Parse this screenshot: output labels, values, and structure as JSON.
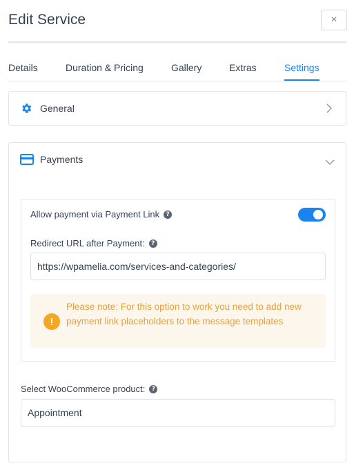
{
  "header": {
    "title": "Edit Service",
    "close_label": "×"
  },
  "tabs": [
    {
      "label": "Details"
    },
    {
      "label": "Duration & Pricing"
    },
    {
      "label": "Gallery"
    },
    {
      "label": "Extras"
    },
    {
      "label": "Settings",
      "active": true
    }
  ],
  "general": {
    "label": "General"
  },
  "payments": {
    "label": "Payments",
    "payment_link_label": "Allow payment via Payment Link",
    "payment_link_enabled": true,
    "redirect_label": "Redirect URL after Payment:",
    "redirect_value": "https://wpamelia.com/services-and-categories/",
    "note": "Please note: For this option to work you need to add new payment link placeholders to the message templates",
    "woo_label": "Select WooCommerce product:",
    "woo_value": "Appointment"
  },
  "colors": {
    "accent": "#1a84ee",
    "warning": "#e6a23c",
    "warning_bg": "#fdf6ec"
  },
  "icons": [
    "close-icon",
    "gear-icon",
    "chevron-right-icon",
    "credit-card-icon",
    "chevron-down-icon",
    "help-icon",
    "warning-icon"
  ]
}
